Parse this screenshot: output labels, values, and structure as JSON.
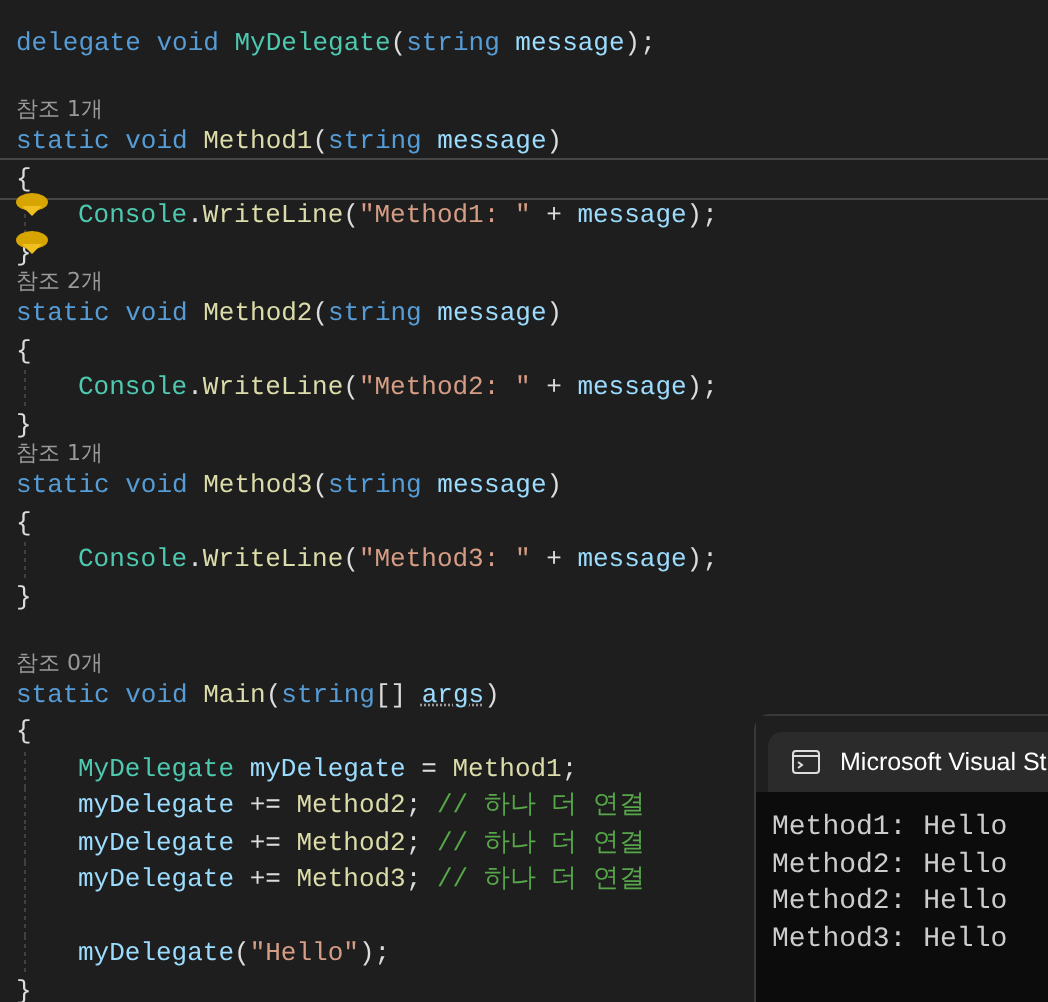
{
  "editor": {
    "lines": [
      {
        "kind": "code",
        "indented": false,
        "tokens": [
          {
            "kind": "keyword",
            "text": "delegate "
          },
          {
            "kind": "keyword",
            "text": "void "
          },
          {
            "kind": "type",
            "text": "MyDelegate"
          },
          {
            "kind": "plain",
            "text": "("
          },
          {
            "kind": "keyword",
            "text": "string "
          },
          {
            "kind": "param",
            "text": "message"
          },
          {
            "kind": "plain",
            "text": ");"
          }
        ]
      },
      {
        "kind": "blank"
      },
      {
        "kind": "codelens",
        "text": "참조 1개"
      },
      {
        "kind": "code",
        "indented": false,
        "tokens": [
          {
            "kind": "keyword",
            "text": "static "
          },
          {
            "kind": "keyword",
            "text": "void "
          },
          {
            "kind": "method",
            "text": "Method1"
          },
          {
            "kind": "plain",
            "text": "("
          },
          {
            "kind": "keyword",
            "text": "string "
          },
          {
            "kind": "param",
            "text": "message"
          },
          {
            "kind": "plain",
            "text": ")"
          }
        ]
      },
      {
        "kind": "code",
        "indented": false,
        "current": true,
        "tokens": [
          {
            "kind": "plain",
            "text": "{"
          }
        ]
      },
      {
        "kind": "code",
        "indented": true,
        "lightbulb": true,
        "tokens": [
          {
            "kind": "type",
            "text": "Console"
          },
          {
            "kind": "plain",
            "text": "."
          },
          {
            "kind": "method",
            "text": "WriteLine"
          },
          {
            "kind": "plain",
            "text": "("
          },
          {
            "kind": "string",
            "text": "\"Method1: \""
          },
          {
            "kind": "plain",
            "text": " + "
          },
          {
            "kind": "param",
            "text": "message"
          },
          {
            "kind": "plain",
            "text": ");"
          }
        ]
      },
      {
        "kind": "code",
        "indented": false,
        "lightbulb": true,
        "tokens": [
          {
            "kind": "plain",
            "text": "}"
          }
        ]
      },
      {
        "kind": "codelens",
        "text": "참조 2개"
      },
      {
        "kind": "code",
        "indented": false,
        "tokens": [
          {
            "kind": "keyword",
            "text": "static "
          },
          {
            "kind": "keyword",
            "text": "void "
          },
          {
            "kind": "method",
            "text": "Method2"
          },
          {
            "kind": "plain",
            "text": "("
          },
          {
            "kind": "keyword",
            "text": "string "
          },
          {
            "kind": "param",
            "text": "message"
          },
          {
            "kind": "plain",
            "text": ")"
          }
        ]
      },
      {
        "kind": "code",
        "indented": false,
        "tokens": [
          {
            "kind": "plain",
            "text": "{"
          }
        ]
      },
      {
        "kind": "code",
        "indented": true,
        "tokens": [
          {
            "kind": "type",
            "text": "Console"
          },
          {
            "kind": "plain",
            "text": "."
          },
          {
            "kind": "method",
            "text": "WriteLine"
          },
          {
            "kind": "plain",
            "text": "("
          },
          {
            "kind": "string",
            "text": "\"Method2: \""
          },
          {
            "kind": "plain",
            "text": " + "
          },
          {
            "kind": "param",
            "text": "message"
          },
          {
            "kind": "plain",
            "text": ");"
          }
        ]
      },
      {
        "kind": "code",
        "indented": false,
        "tokens": [
          {
            "kind": "plain",
            "text": "}"
          }
        ]
      },
      {
        "kind": "codelens",
        "text": "참조 1개"
      },
      {
        "kind": "code",
        "indented": false,
        "tokens": [
          {
            "kind": "keyword",
            "text": "static "
          },
          {
            "kind": "keyword",
            "text": "void "
          },
          {
            "kind": "method",
            "text": "Method3"
          },
          {
            "kind": "plain",
            "text": "("
          },
          {
            "kind": "keyword",
            "text": "string "
          },
          {
            "kind": "param",
            "text": "message"
          },
          {
            "kind": "plain",
            "text": ")"
          }
        ]
      },
      {
        "kind": "code",
        "indented": false,
        "tokens": [
          {
            "kind": "plain",
            "text": "{"
          }
        ]
      },
      {
        "kind": "code",
        "indented": true,
        "tokens": [
          {
            "kind": "type",
            "text": "Console"
          },
          {
            "kind": "plain",
            "text": "."
          },
          {
            "kind": "method",
            "text": "WriteLine"
          },
          {
            "kind": "plain",
            "text": "("
          },
          {
            "kind": "string",
            "text": "\"Method3: \""
          },
          {
            "kind": "plain",
            "text": " + "
          },
          {
            "kind": "param",
            "text": "message"
          },
          {
            "kind": "plain",
            "text": ");"
          }
        ]
      },
      {
        "kind": "code",
        "indented": false,
        "tokens": [
          {
            "kind": "plain",
            "text": "}"
          }
        ]
      },
      {
        "kind": "blank"
      },
      {
        "kind": "codelens",
        "text": "참조 0개"
      },
      {
        "kind": "code",
        "indented": false,
        "tokens": [
          {
            "kind": "keyword",
            "text": "static "
          },
          {
            "kind": "keyword",
            "text": "void "
          },
          {
            "kind": "method",
            "text": "Main"
          },
          {
            "kind": "plain",
            "text": "("
          },
          {
            "kind": "keyword",
            "text": "string"
          },
          {
            "kind": "plain",
            "text": "[] "
          },
          {
            "kind": "param",
            "text": "args",
            "underlined": true
          },
          {
            "kind": "plain",
            "text": ")"
          }
        ]
      },
      {
        "kind": "code",
        "indented": false,
        "tokens": [
          {
            "kind": "plain",
            "text": "{"
          }
        ]
      },
      {
        "kind": "code",
        "indented": true,
        "tokens": [
          {
            "kind": "type",
            "text": "MyDelegate "
          },
          {
            "kind": "param",
            "text": "myDelegate"
          },
          {
            "kind": "plain",
            "text": " = "
          },
          {
            "kind": "method",
            "text": "Method1"
          },
          {
            "kind": "plain",
            "text": ";"
          }
        ]
      },
      {
        "kind": "code",
        "indented": true,
        "tokens": [
          {
            "kind": "param",
            "text": "myDelegate"
          },
          {
            "kind": "plain",
            "text": " += "
          },
          {
            "kind": "method",
            "text": "Method2"
          },
          {
            "kind": "plain",
            "text": "; "
          },
          {
            "kind": "comment",
            "text": "// 하나 더 연결"
          }
        ]
      },
      {
        "kind": "code",
        "indented": true,
        "tokens": [
          {
            "kind": "param",
            "text": "myDelegate"
          },
          {
            "kind": "plain",
            "text": " += "
          },
          {
            "kind": "method",
            "text": "Method2"
          },
          {
            "kind": "plain",
            "text": "; "
          },
          {
            "kind": "comment",
            "text": "// 하나 더 연결"
          }
        ]
      },
      {
        "kind": "code",
        "indented": true,
        "tokens": [
          {
            "kind": "param",
            "text": "myDelegate"
          },
          {
            "kind": "plain",
            "text": " += "
          },
          {
            "kind": "method",
            "text": "Method3"
          },
          {
            "kind": "plain",
            "text": "; "
          },
          {
            "kind": "comment",
            "text": "// 하나 더 연결"
          }
        ]
      },
      {
        "kind": "blank",
        "indented": true
      },
      {
        "kind": "code",
        "indented": true,
        "tokens": [
          {
            "kind": "param",
            "text": "myDelegate"
          },
          {
            "kind": "plain",
            "text": "("
          },
          {
            "kind": "string",
            "text": "\"Hello\""
          },
          {
            "kind": "plain",
            "text": ");"
          }
        ]
      },
      {
        "kind": "code",
        "indented": false,
        "tokens": [
          {
            "kind": "plain",
            "text": "}"
          }
        ]
      }
    ]
  },
  "console": {
    "title": "Microsoft Visual St",
    "output": [
      "Method1: Hello",
      "Method2: Hello",
      "Method2: Hello",
      "Method3: Hello"
    ]
  }
}
